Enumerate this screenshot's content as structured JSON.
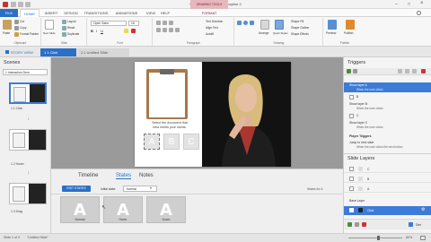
{
  "window": {
    "title": "Untitled1* - Articulate Storyline 2",
    "context_tab": "DRAWING TOOLS"
  },
  "tabs": [
    "FILE",
    "HOME",
    "INSERT",
    "DESIGN",
    "TRANSITIONS",
    "ANIMATIONS",
    "VIEW",
    "HELP",
    "FORMAT"
  ],
  "ribbon": {
    "clipboard": {
      "label": "Clipboard",
      "paste": "Paste",
      "cut": "Cut",
      "copy": "Copy",
      "format_painter": "Format Painter"
    },
    "slide": {
      "label": "Slide",
      "new_slide": "New Slide",
      "layout": "Layout",
      "reset": "Reset",
      "duplicate": "Duplicate"
    },
    "font": {
      "label": "Font",
      "font_name": "Open Sans",
      "font_size": "16"
    },
    "paragraph": {
      "label": "Paragraph",
      "text_direction": "Text Direction",
      "align_text": "Align Text",
      "autofit": "Autofit"
    },
    "drawing": {
      "label": "Drawing",
      "arrange": "Arrange",
      "quick_styles": "Quick Styles",
      "shape_fill": "Shape Fill",
      "shape_outline": "Shape Outline",
      "shape_effects": "Shape Effects"
    },
    "publish": {
      "label": "Publish",
      "preview": "Preview",
      "publish": "Publish"
    }
  },
  "slide_tabs": {
    "story_view": "STORY VIEW",
    "active": "1.1 Click",
    "other": "2.1 Untitled Slide"
  },
  "scenes": {
    "title": "Scenes",
    "scene_select": "1 Interaction Dem",
    "slides": [
      {
        "label": "1.1 Click"
      },
      {
        "label": "1.2 Hover"
      },
      {
        "label": "1.3 Drag"
      }
    ]
  },
  "slide_content": {
    "caption_line1": "Select the document that",
    "caption_line2": "best meets your needs.",
    "tiles": [
      "A",
      "B",
      "C"
    ]
  },
  "bottom": {
    "tabs": [
      "Timeline",
      "States",
      "Notes"
    ],
    "edit_states": "EDIT STATES",
    "initial_state_label": "Initial state:",
    "initial_state_value": "Normal",
    "states_for": "States for A",
    "states": [
      {
        "letter": "A",
        "label": "Normal"
      },
      {
        "letter": "A",
        "label": "Hover"
      },
      {
        "letter": "A",
        "label": "Down"
      }
    ]
  },
  "triggers": {
    "title": "Triggers",
    "items": [
      {
        "title": "Show layer A",
        "sub": "When the user clicks",
        "selected": true
      },
      {
        "title": "B",
        "sub": ""
      },
      {
        "title": "Show layer B",
        "sub": "When the user clicks"
      },
      {
        "title": "C",
        "sub": ""
      },
      {
        "title": "Show layer C",
        "sub": "When the user clicks"
      }
    ],
    "player_triggers": "Player Triggers",
    "player_items": [
      {
        "title": "Jump to next slide",
        "sub": "When the user clicks the next button"
      }
    ]
  },
  "layers": {
    "title": "Slide Layers",
    "items": [
      "C",
      "B",
      "A"
    ],
    "base_label": "Base Layer",
    "base_item": "Click",
    "dim": "Dim"
  },
  "status": {
    "slide_of": "Slide 1 of 3",
    "slide_name": "\"Untitled Slide\"",
    "zoom": "82%"
  },
  "colors": {
    "accent": "#2b6fc6",
    "selected": "#3d7bd8",
    "file_tab": "#2b6fc6"
  }
}
